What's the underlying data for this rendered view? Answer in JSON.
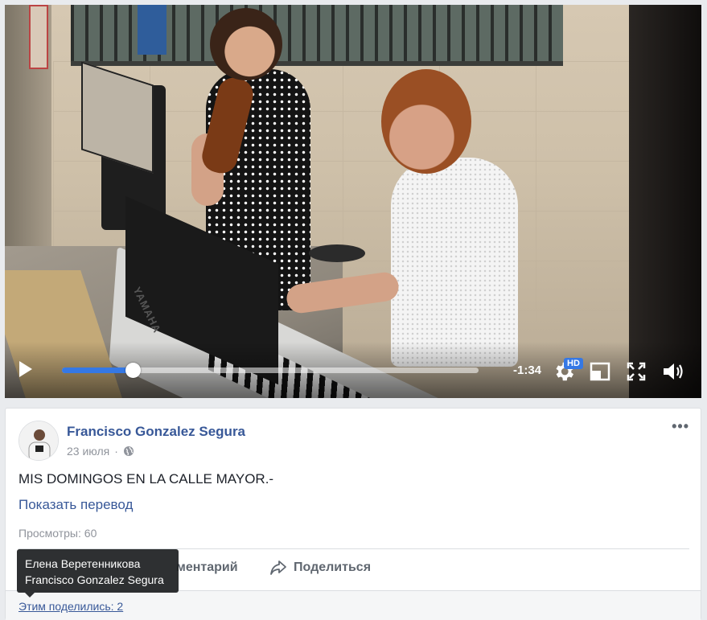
{
  "video": {
    "time_remaining": "-1:34",
    "progress_fraction": 0.17,
    "hd_label": "HD",
    "keyboard_brand": "YAMAHA"
  },
  "post": {
    "author": "Francisco Gonzalez Segura",
    "date": "23 июля",
    "separator": "·",
    "text": "MIS DOMINGOS EN LA CALLE MAYOR.-",
    "translate_link": "Показать перевод",
    "views": "Просмотры: 60",
    "more_label": "•••"
  },
  "actions": {
    "comment_label": "ментарий",
    "share_label": "Поделиться"
  },
  "footer": {
    "shares_link": "Этим поделились: 2"
  },
  "tooltip": {
    "lines": [
      "Елена Веретенникова",
      "Francisco Gonzalez Segura"
    ]
  },
  "colors": {
    "link": "#385898",
    "accent": "#3578e5",
    "background": "#e9ebee"
  }
}
